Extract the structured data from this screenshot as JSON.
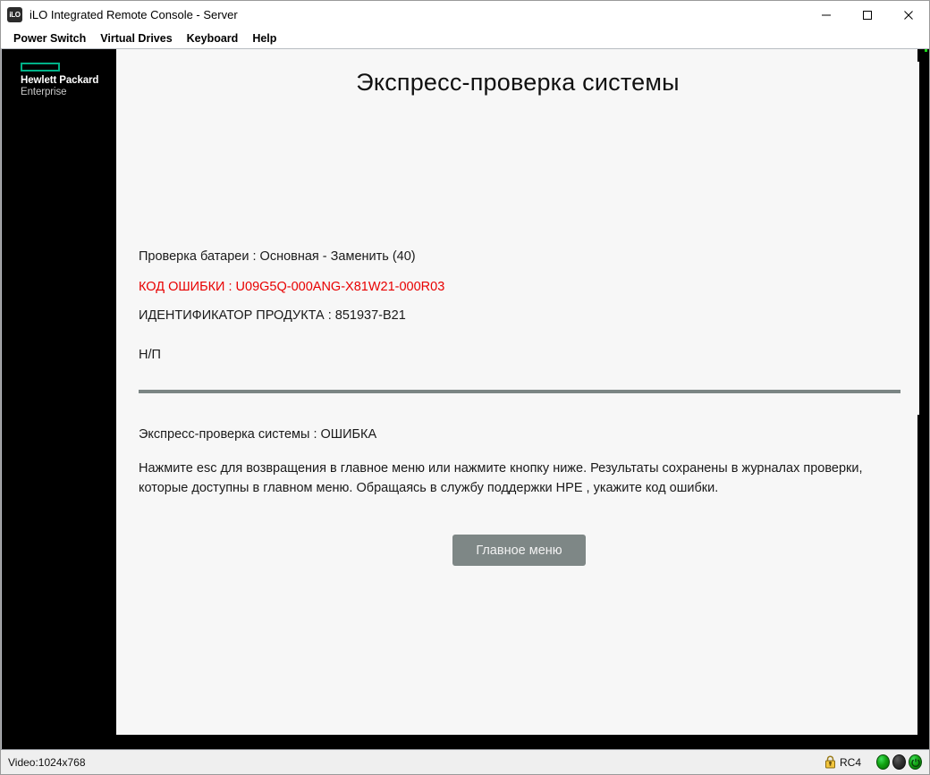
{
  "window": {
    "icon_label": "iLO",
    "title": "iLO Integrated Remote Console - Server",
    "controls": {
      "minimize": "minimize-button",
      "maximize": "maximize-button",
      "close": "close-button"
    }
  },
  "menu": {
    "items": [
      {
        "label": "Power Switch"
      },
      {
        "label": "Virtual Drives"
      },
      {
        "label": "Keyboard"
      },
      {
        "label": "Help"
      }
    ]
  },
  "console": {
    "branding": {
      "line1": "Hewlett Packard",
      "line2": "Enterprise",
      "mark_color": "#00b188"
    },
    "screen": {
      "title": "Экспресс-проверка системы",
      "battery_check": "Проверка батареи : Основная - Заменить (40)",
      "error_code_label": "КОД ОШИБКИ : U09G5Q-000ANG-X81W21-000R03",
      "error_code_color": "#e80000",
      "product_id_label": "ИДЕНТИФИКАТОР ПРОДУКТА : 851937-B21",
      "na_text": "Н/П",
      "result_line": "Экспресс-проверка системы : ОШИБКА",
      "instructions": "Нажмите esc для возвращения в главное меню или нажмите кнопку ниже. Результаты сохранены в журналах проверки, которые доступны в главном меню. Обращаясь в службу поддержки HPE , укажите код ошибки.",
      "main_menu_button": "Главное меню",
      "divider_color": "#7b8584"
    }
  },
  "status_bar": {
    "video_mode": "Video:1024x768",
    "cipher": "RC4",
    "lock_icon": "padlock-icon",
    "leds": [
      {
        "name": "led-green",
        "color": "#12a312"
      },
      {
        "name": "led-off",
        "color": "#333333"
      },
      {
        "name": "led-power",
        "color": "#12a312"
      }
    ]
  }
}
